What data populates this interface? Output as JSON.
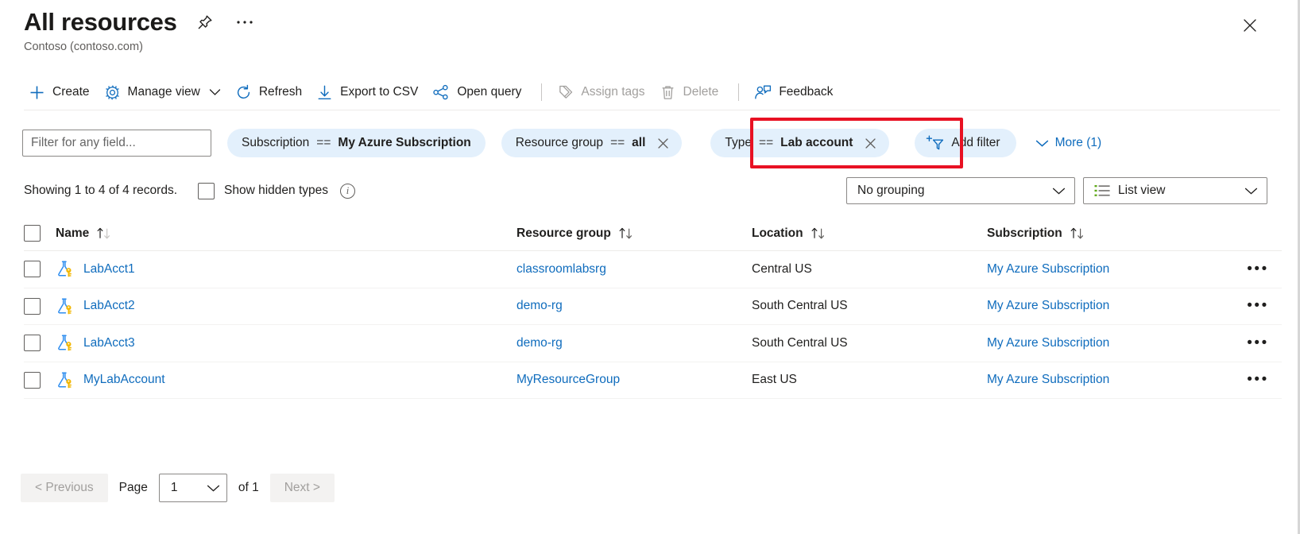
{
  "header": {
    "title": "All resources",
    "subtitle": "Contoso (contoso.com)",
    "pin_icon": "pin-icon",
    "more_icon": "ellipsis-icon",
    "close_icon": "close-icon"
  },
  "toolbar": {
    "create": "Create",
    "manage_view": "Manage view",
    "refresh": "Refresh",
    "export_csv": "Export to CSV",
    "open_query": "Open query",
    "assign_tags": "Assign tags",
    "delete": "Delete",
    "feedback": "Feedback"
  },
  "filters": {
    "search_placeholder": "Filter for any field...",
    "search_value": "",
    "pills": [
      {
        "field": "Subscription",
        "op": "==",
        "value": "My Azure Subscription",
        "closable": false
      },
      {
        "field": "Resource group",
        "op": "==",
        "value": "all",
        "closable": true
      },
      {
        "field": "Type",
        "op": "==",
        "value": "Lab account",
        "closable": true,
        "highlighted": true
      }
    ],
    "add_filter": "Add filter",
    "more": "More (1)",
    "highlight_color": "#e81123"
  },
  "meta": {
    "showing": "Showing 1 to 4 of 4 records.",
    "show_hidden_types": "Show hidden types",
    "show_hidden_checked": false,
    "info_icon": "info-icon",
    "grouping": "No grouping",
    "view": "List view"
  },
  "table": {
    "columns": [
      {
        "label": "Name",
        "sortable": true
      },
      {
        "label": "Resource group",
        "sortable": true
      },
      {
        "label": "Location",
        "sortable": true
      },
      {
        "label": "Subscription",
        "sortable": true
      }
    ],
    "rows": [
      {
        "name": "LabAcct1",
        "icon": "lab-account-icon",
        "resource_group": "classroomlabsrg",
        "location": "Central US",
        "subscription": "My Azure Subscription"
      },
      {
        "name": "LabAcct2",
        "icon": "lab-account-icon",
        "resource_group": "demo-rg",
        "location": "South Central US",
        "subscription": "My Azure Subscription"
      },
      {
        "name": "LabAcct3",
        "icon": "lab-account-icon",
        "resource_group": "demo-rg",
        "location": "South Central US",
        "subscription": "My Azure Subscription"
      },
      {
        "name": "MyLabAccount",
        "icon": "lab-account-icon",
        "resource_group": "MyResourceGroup",
        "location": "East US",
        "subscription": "My Azure Subscription"
      }
    ],
    "row_menu_icon": "ellipsis-icon"
  },
  "pagination": {
    "previous": "< Previous",
    "next": "Next >",
    "page_label": "Page",
    "page_value": "1",
    "of_label": "of 1"
  },
  "colors": {
    "link": "#0f6cbd",
    "pill_bg": "#e3f0fc",
    "accent": "#0078d4",
    "disabled": "#a19f9d"
  }
}
